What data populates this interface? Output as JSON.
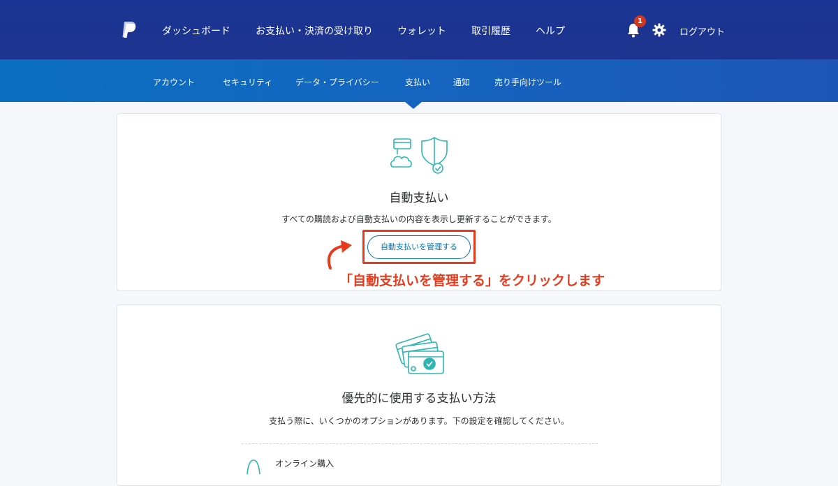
{
  "header": {
    "nav": [
      "ダッシュボード",
      "お支払い・決済の受け取り",
      "ウォレット",
      "取引履歴",
      "ヘルプ"
    ],
    "notification_count": "1",
    "logout_label": "ログアウト",
    "colors": {
      "primary": "#1d3590",
      "accent": "#0070ba",
      "badge": "#d1391f"
    }
  },
  "subnav": {
    "items": [
      "アカウント",
      "セキュリティ",
      "データ・プライバシー",
      "支払い",
      "通知",
      "売り手向けツール"
    ],
    "active": "支払い"
  },
  "auto_payments": {
    "icon": "shield-cloud-card-icon",
    "title": "自動支払い",
    "description": "すべての購読および自動支払いの内容を表示し更新することができます。",
    "button_label": "自動支払いを管理する"
  },
  "annotation": {
    "text": "「自動支払いを管理する」をクリックします",
    "color": "#e83a1d"
  },
  "preferred_payment": {
    "icon": "stacked-cards-icon",
    "title": "優先的に使用する支払い方法",
    "description": "支払う際に、いくつかのオプションがあります。下の設定を確認してください。",
    "option_label": "オンライン購入"
  }
}
